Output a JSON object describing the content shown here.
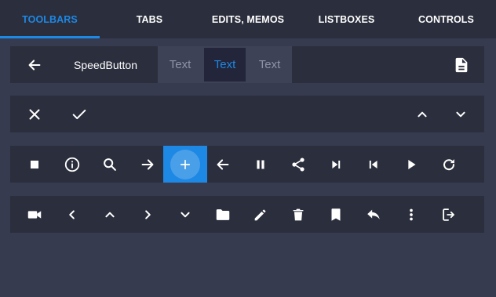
{
  "tabs": [
    {
      "label": "TOOLBARS",
      "active": true
    },
    {
      "label": "TABS",
      "active": false
    },
    {
      "label": "EDITS, MEMOS",
      "active": false
    },
    {
      "label": "LISTBOXES",
      "active": false
    },
    {
      "label": "CONTROLS",
      "active": false
    }
  ],
  "accent_color": "#1e88e5",
  "toolbar1": {
    "back_icon": "arrow-left-icon",
    "speed_button_label": "SpeedButton",
    "segments": [
      {
        "label": "Text",
        "selected": false
      },
      {
        "label": "Text",
        "selected": true
      },
      {
        "label": "Text",
        "selected": false
      }
    ],
    "document_icon": "document-icon"
  },
  "toolbar2": {
    "icons": [
      "close-icon",
      "check-icon",
      "chevron-up-icon",
      "chevron-down-icon"
    ]
  },
  "toolbar3": {
    "icons": [
      "stop-icon",
      "info-icon",
      "search-icon",
      "arrow-right-icon",
      "add-icon",
      "arrow-left-icon",
      "pause-icon",
      "share-icon",
      "skip-next-icon",
      "skip-previous-icon",
      "play-icon",
      "refresh-icon"
    ],
    "highlighted": "add-icon"
  },
  "toolbar4": {
    "icons": [
      "video-camera-icon",
      "chevron-left-icon",
      "chevron-up-icon",
      "chevron-right-icon",
      "chevron-down-icon",
      "folder-icon",
      "pencil-icon",
      "trash-icon",
      "bookmark-icon",
      "reply-icon",
      "more-vertical-icon",
      "exit-icon"
    ]
  }
}
